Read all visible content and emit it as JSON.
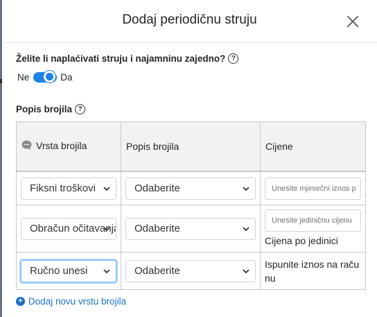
{
  "modal": {
    "title": "Dodaj periodičnu struju",
    "question": "Želite li naplaćivati struju i najamninu zajedno?",
    "toggle": {
      "off_label": "Ne",
      "on_label": "Da",
      "state": "on"
    },
    "section_label": "Popis brojila",
    "table": {
      "headers": {
        "type": "Vrsta brojila",
        "list": "Popis brojila",
        "price": "Cijene"
      },
      "rows": [
        {
          "type": "Fiksni troškovi",
          "list": "Odaberite",
          "price_placeholder": "Unesite mjesečni iznos p",
          "note": ""
        },
        {
          "type": "Obračun očitavanja",
          "list": "Odaberite",
          "price_placeholder": "Unesite jediničnu cijenu",
          "note": "Cijena po jedinici"
        },
        {
          "type": "Ručno unesi",
          "list": "Odaberite",
          "price_placeholder": "",
          "note": "Ispunite iznos na računu"
        }
      ]
    },
    "add_link": "Dodaj novu vrstu brojila"
  },
  "colors": {
    "accent": "#1e82e6",
    "link": "#1a73c8",
    "header_bg": "#f2f2f2"
  }
}
